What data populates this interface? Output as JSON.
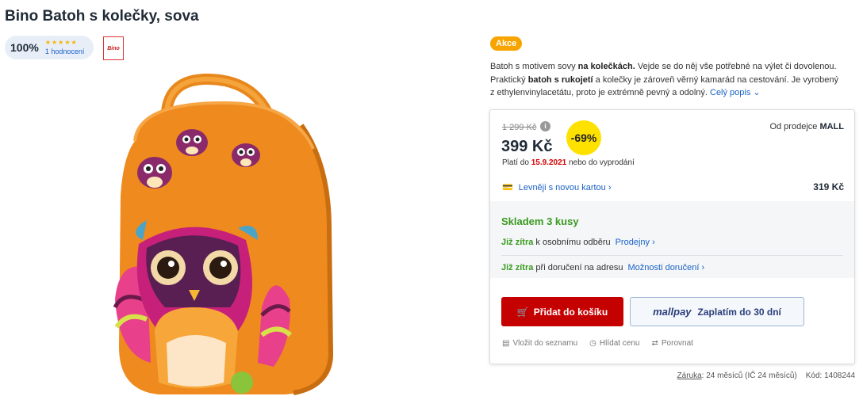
{
  "product": {
    "title": "Bino Batoh s kolečky, sova",
    "rating_percent": "100%",
    "rating_count": "1 hodnocení",
    "stars": "★★★★★",
    "brand_logo_text": "Bino"
  },
  "badge": {
    "label": "Akce"
  },
  "description": {
    "p1": "Batoh s motivem sovy ",
    "b1": "na kolečkách.",
    "p2": " Vejde se do něj vše potřebné na výlet či dovolenou. Praktický ",
    "b2": "batoh s rukojetí",
    "p3": " a kolečky je zároveň věrný kamarád na cestování. Je vyrobený z ethylenvinylacetátu, proto je extrémně pevný a odolný.",
    "more_label": "Celý popis"
  },
  "offer": {
    "old_price": "1 299 Kč",
    "info_icon": "i",
    "price": "399 Kč",
    "discount": "-69%",
    "seller_prefix": "Od prodejce",
    "seller": "MALL",
    "valid_prefix": "Platí do",
    "valid_date": "15.9.2021",
    "valid_suffix": "nebo do vyprodání",
    "card_offer_label": "Levněji s novou kartou",
    "card_price": "319 Kč"
  },
  "delivery": {
    "stock": "Skladem 3 kusy",
    "row1_green": "Již zítra",
    "row1_text": "k osobnímu odběru",
    "row1_link": "Prodejny",
    "row2_green": "Již zítra",
    "row2_text": "při doručení na adresu",
    "row2_link": "Možnosti doručení"
  },
  "buttons": {
    "cart": "Přidat do košíku",
    "mallpay_logo": "mallpay",
    "mallpay_text": "Zaplatím do 30 dní"
  },
  "actions": {
    "wishlist": "Vložit do seznamu",
    "watch": "Hlídat cenu",
    "compare": "Porovnat"
  },
  "footer": {
    "warranty_label": "Záruka",
    "warranty_value": ": 24 měsíců (IČ 24 měsíců)",
    "code": "Kód: 1408244"
  },
  "colors": {
    "accent_red": "#c40000",
    "akce_orange": "#f7a400",
    "discount_yellow": "#ffe100",
    "stock_green": "#3a9a1e",
    "link_blue": "#1a62c6"
  }
}
